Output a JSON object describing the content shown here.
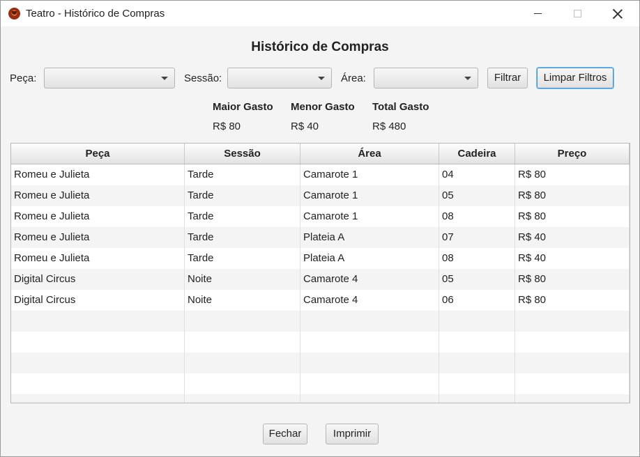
{
  "window": {
    "title": "Teatro - Histórico de Compras",
    "app_icon": "theater-mask-icon"
  },
  "heading": "Histórico de Compras",
  "filters": {
    "peca_label": "Peça:",
    "sessao_label": "Sessão:",
    "area_label": "Área:",
    "peca_value": "",
    "sessao_value": "",
    "area_value": "",
    "filter_button": "Filtrar",
    "clear_button": "Limpar Filtros"
  },
  "stats": {
    "max_label": "Maior Gasto",
    "max_value": "R$ 80",
    "min_label": "Menor Gasto",
    "min_value": "R$ 40",
    "total_label": "Total Gasto",
    "total_value": "R$ 480"
  },
  "table": {
    "columns": [
      "Peça",
      "Sessão",
      "Área",
      "Cadeira",
      "Preço"
    ],
    "rows": [
      [
        "Romeu e Julieta",
        "Tarde",
        "Camarote 1",
        "04",
        "R$ 80"
      ],
      [
        "Romeu e Julieta",
        "Tarde",
        "Camarote 1",
        "05",
        "R$ 80"
      ],
      [
        "Romeu e Julieta",
        "Tarde",
        "Camarote 1",
        "08",
        "R$ 80"
      ],
      [
        "Romeu e Julieta",
        "Tarde",
        "Plateia A",
        "07",
        "R$ 40"
      ],
      [
        "Romeu e Julieta",
        "Tarde",
        "Plateia A",
        "08",
        "R$ 40"
      ],
      [
        "Digital Circus",
        "Noite",
        "Camarote 4",
        "05",
        "R$ 80"
      ],
      [
        "Digital Circus",
        "Noite",
        "Camarote 4",
        "06",
        "R$ 80"
      ]
    ]
  },
  "footer": {
    "close_button": "Fechar",
    "print_button": "Imprimir"
  }
}
